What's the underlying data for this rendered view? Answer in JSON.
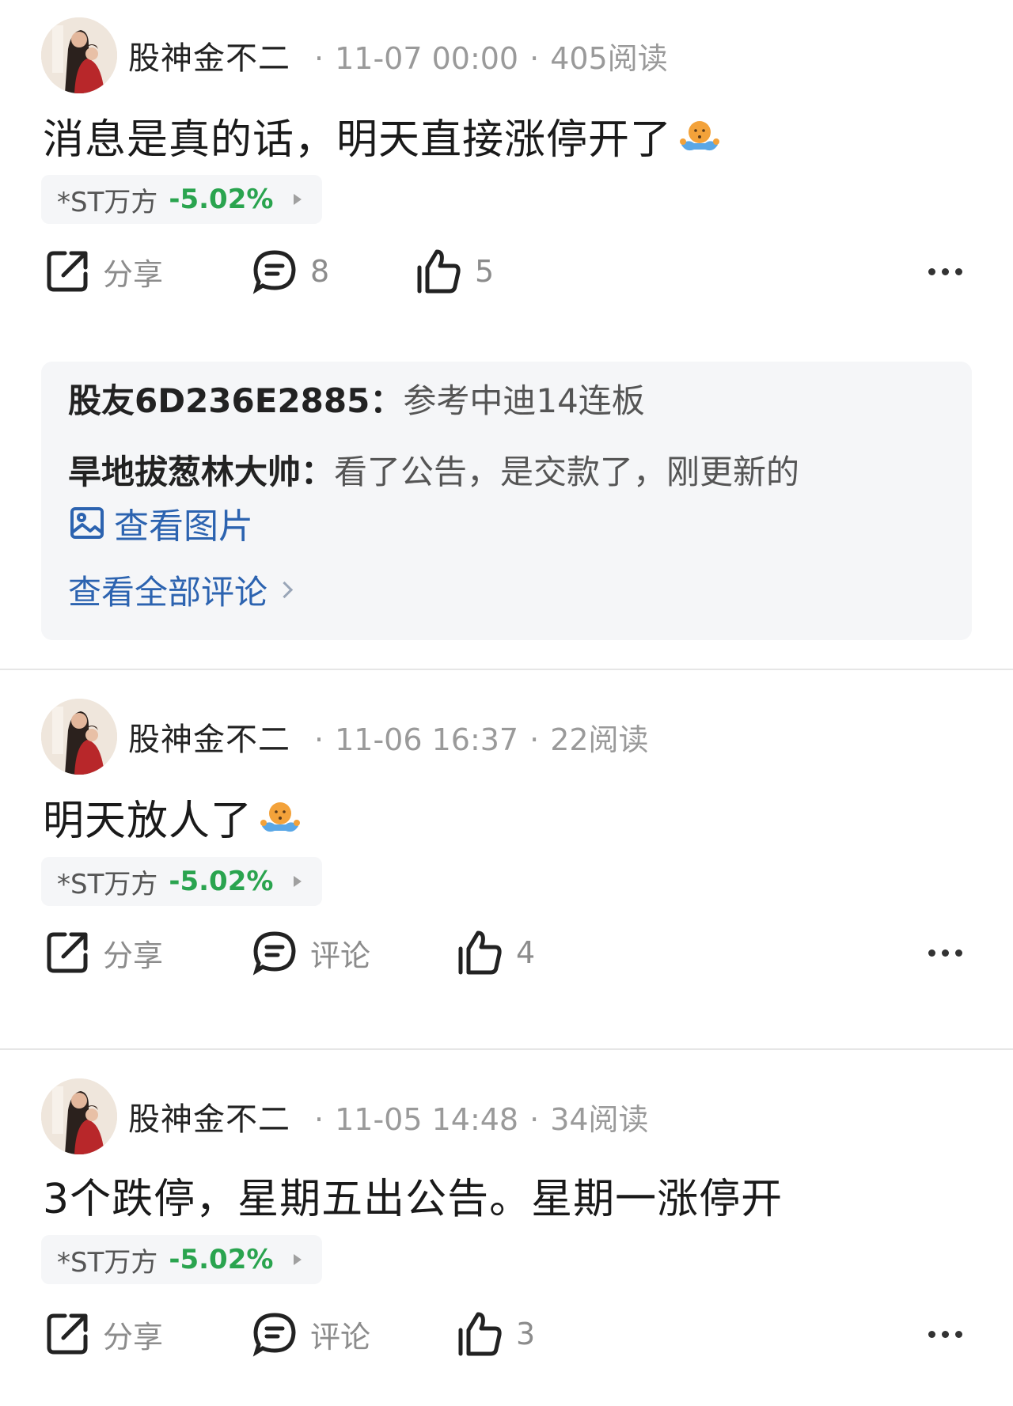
{
  "posts": [
    {
      "author": "股神金不二",
      "time": "11-07 00:00",
      "reads": "405阅读",
      "content": "消息是真的话，明天直接涨停开了",
      "stock": {
        "name": "*ST万方",
        "change": "-5.02%"
      },
      "actions": {
        "share": "分享",
        "comments": "8",
        "likes": "5"
      },
      "comments": [
        {
          "user": "股友6D236E2885",
          "text": "参考中迪14连板"
        },
        {
          "user": "旱地拔葱林大帅",
          "text": "看了公告，是交款了，刚更新的"
        }
      ],
      "view_image": "查看图片",
      "view_all": "查看全部评论"
    },
    {
      "author": "股神金不二",
      "time": "11-06 16:37",
      "reads": "22阅读",
      "content": "明天放人了",
      "stock": {
        "name": "*ST万方",
        "change": "-5.02%"
      },
      "actions": {
        "share": "分享",
        "comments": "评论",
        "likes": "4"
      }
    },
    {
      "author": "股神金不二",
      "time": "11-05 14:48",
      "reads": "34阅读",
      "content": "3个跌停，星期五出公告。星期一涨停开",
      "stock": {
        "name": "*ST万方",
        "change": "-5.02%"
      },
      "actions": {
        "share": "分享",
        "comments": "评论",
        "likes": "3"
      }
    }
  ],
  "colors": {
    "down": "#2aa44f",
    "link": "#2c63b0",
    "meta": "#9a9a9a"
  },
  "icons": [
    "avatar",
    "shrug-emoji-icon",
    "share-icon",
    "comment-icon",
    "like-icon",
    "more-icon",
    "image-icon",
    "chevron-right-icon"
  ]
}
